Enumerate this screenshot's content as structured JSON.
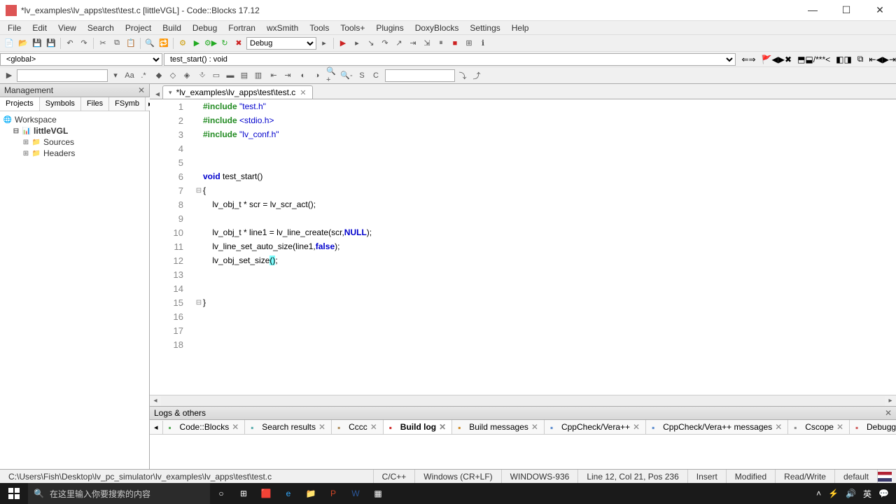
{
  "window": {
    "title": "*lv_examples\\lv_apps\\test\\test.c [littleVGL] - Code::Blocks 17.12"
  },
  "menu": [
    "File",
    "Edit",
    "View",
    "Search",
    "Project",
    "Build",
    "Debug",
    "Fortran",
    "wxSmith",
    "Tools",
    "Tools+",
    "Plugins",
    "DoxyBlocks",
    "Settings",
    "Help"
  ],
  "build_target": "Debug",
  "scope": {
    "left": "<global>",
    "right": "test_start() : void"
  },
  "sidebar": {
    "title": "Management",
    "tabs": [
      "Projects",
      "Symbols",
      "Files",
      "FSymb"
    ],
    "workspace": "Workspace",
    "project": "littleVGL",
    "folders": [
      "Sources",
      "Headers"
    ]
  },
  "editor": {
    "tab": "*lv_examples\\lv_apps\\test\\test.c",
    "lines": [
      {
        "n": 1,
        "tokens": [
          {
            "t": "#include ",
            "c": "kw2"
          },
          {
            "t": "\"test.h\"",
            "c": "str"
          }
        ]
      },
      {
        "n": 2,
        "tokens": [
          {
            "t": "#include ",
            "c": "kw2"
          },
          {
            "t": "<stdio.h>",
            "c": "str"
          }
        ]
      },
      {
        "n": 3,
        "tokens": [
          {
            "t": "#include ",
            "c": "kw2"
          },
          {
            "t": "\"lv_conf.h\"",
            "c": "str"
          }
        ]
      },
      {
        "n": 4,
        "tokens": []
      },
      {
        "n": 5,
        "tokens": []
      },
      {
        "n": 6,
        "tokens": [
          {
            "t": "void",
            "c": "kw"
          },
          {
            "t": " test_start",
            "c": "func"
          },
          {
            "t": "()",
            "c": ""
          }
        ]
      },
      {
        "n": 7,
        "fold": "-",
        "tokens": [
          {
            "t": "{",
            "c": ""
          }
        ]
      },
      {
        "n": 8,
        "tokens": [
          {
            "t": "    lv_obj_t * scr = lv_scr_act();",
            "c": ""
          }
        ]
      },
      {
        "n": 9,
        "tokens": []
      },
      {
        "n": 10,
        "marker": "green",
        "tokens": [
          {
            "t": "    lv_obj_t * line1 = lv_line_create(scr,",
            "c": ""
          },
          {
            "t": "NULL",
            "c": "kw"
          },
          {
            "t": ");",
            "c": ""
          }
        ]
      },
      {
        "n": 11,
        "marker": "green",
        "tokens": [
          {
            "t": "    lv_line_set_auto_size(line1,",
            "c": ""
          },
          {
            "t": "false",
            "c": "kw"
          },
          {
            "t": ");",
            "c": ""
          }
        ]
      },
      {
        "n": 12,
        "marker": "yellow",
        "tokens": [
          {
            "t": "    lv_obj_set_size",
            "c": ""
          },
          {
            "t": "(",
            "c": "paren-hl"
          },
          {
            "t": ")",
            "c": "paren-hl"
          },
          {
            "t": ";",
            "c": ""
          }
        ]
      },
      {
        "n": 13,
        "tokens": []
      },
      {
        "n": 14,
        "tokens": []
      },
      {
        "n": 15,
        "fold": "-",
        "tokens": [
          {
            "t": "}",
            "c": ""
          }
        ]
      },
      {
        "n": 16,
        "tokens": []
      },
      {
        "n": 17,
        "tokens": []
      },
      {
        "n": 18,
        "tokens": []
      }
    ]
  },
  "logs": {
    "title": "Logs & others",
    "tabs": [
      "Code::Blocks",
      "Search results",
      "Cccc",
      "Build log",
      "Build messages",
      "CppCheck/Vera++",
      "CppCheck/Vera++ messages",
      "Cscope",
      "Debugger"
    ],
    "active": 3
  },
  "status": {
    "path": "C:\\Users\\Fish\\Desktop\\lv_pc_simulator\\lv_examples\\lv_apps\\test\\test.c",
    "lang": "C/C++",
    "eol": "Windows (CR+LF)",
    "encoding": "WINDOWS-936",
    "pos": "Line 12, Col 21, Pos 236",
    "insert": "Insert",
    "modified": "Modified",
    "rw": "Read/Write",
    "profile": "default"
  },
  "taskbar": {
    "search_placeholder": "在这里输入你要搜索的内容",
    "time": "",
    "ime": "英"
  }
}
